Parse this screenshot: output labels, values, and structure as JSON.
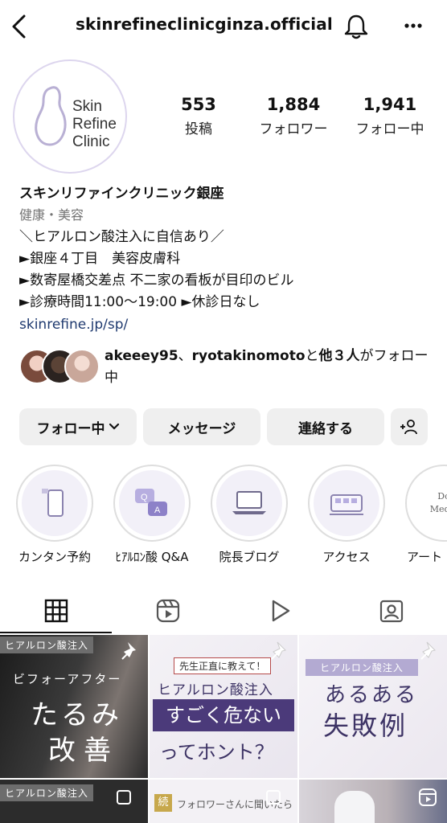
{
  "header": {
    "username": "skinrefineclinicginza.official"
  },
  "profile": {
    "logo_text": [
      "Skin",
      "Refine",
      "Clinic"
    ],
    "stats": [
      {
        "value": "553",
        "label": "投稿"
      },
      {
        "value": "1,884",
        "label": "フォロワー"
      },
      {
        "value": "1,941",
        "label": "フォロー中"
      }
    ],
    "name": "スキンリファインクリニック銀座",
    "category": "健康・美容",
    "bio_lines": [
      "＼ヒアルロン酸注入に自信あり／",
      "►銀座４丁目　美容皮膚科",
      "►数寄屋橋交差点 不二家の看板が目印のビル",
      "►診療時間11:00〜19:00 ►休診日なし"
    ],
    "link": "skinrefine.jp/sp/"
  },
  "followed_by": {
    "user1": "akeeey95",
    "sep": "、",
    "user2": "ryotakinomoto",
    "and": "と",
    "others": "他３人",
    "suffix": "がフォロー中"
  },
  "buttons": {
    "following": "フォロー中",
    "message": "メッセージ",
    "contact": "連絡する"
  },
  "highlights": [
    {
      "label": "カンタン予約",
      "icon": "phone-icon"
    },
    {
      "label": "ﾋｱﾙﾛﾝ酸 Q&A",
      "icon": "qa-chat-icon"
    },
    {
      "label": "院長ブログ",
      "icon": "laptop-icon"
    },
    {
      "label": "アクセス",
      "icon": "train-icon"
    },
    {
      "label": "アート",
      "icon": "doctor-icon",
      "thumb_text": [
        "Do",
        "Medic"
      ]
    }
  ],
  "posts": [
    {
      "tag": "ヒアルロン酸注入",
      "sub": "ビフォーアフター",
      "line1": "たるみ",
      "line2": "改善"
    },
    {
      "badge": "先生正直に教えて！",
      "line1": "ヒアルロン酸注入",
      "line2": "すごく危ない",
      "line3": "ってホント？"
    },
    {
      "tag": "ヒアルロン酸注入",
      "line1": "あるある",
      "line2": "失敗例"
    },
    {
      "tag": "ヒアルロン酸注入"
    },
    {
      "badge_char": "続",
      "line1": "フォロワーさんに聞いたら"
    },
    {}
  ],
  "colors": {
    "link": "#1f3a6f",
    "accent_purple": "#4b3a7a",
    "button_bg": "#efefef"
  }
}
